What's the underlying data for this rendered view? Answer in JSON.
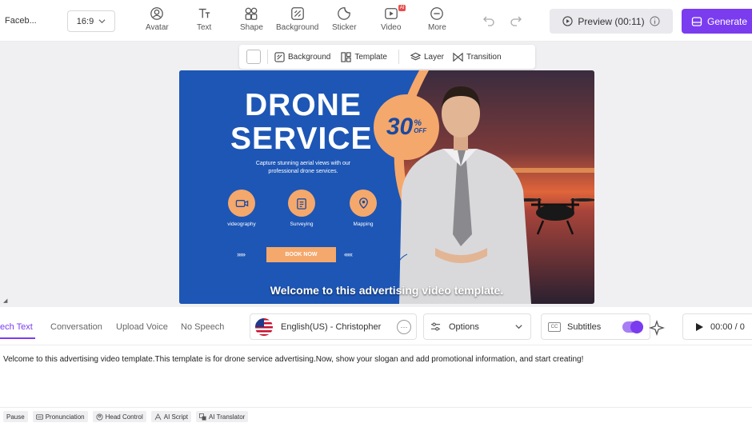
{
  "topbar": {
    "project_name": "Faceb...",
    "aspect_ratio": "16:9",
    "tools": [
      {
        "label": "Avatar",
        "icon": "avatar-icon"
      },
      {
        "label": "Text",
        "icon": "text-icon"
      },
      {
        "label": "Shape",
        "icon": "shape-icon"
      },
      {
        "label": "Background",
        "icon": "background-icon"
      },
      {
        "label": "Sticker",
        "icon": "sticker-icon"
      },
      {
        "label": "Video",
        "icon": "video-icon",
        "badge": "AI"
      },
      {
        "label": "More",
        "icon": "more-icon"
      }
    ],
    "preview_label": "Preview (00:11)",
    "generate_label": "Generate"
  },
  "subtoolbar": {
    "background_label": "Background",
    "template_label": "Template",
    "layer_label": "Layer",
    "transition_label": "Transition"
  },
  "video": {
    "title_line1": "DRONE",
    "title_line2": "SERVICE",
    "subtitle_line1": "Capture stunning aerial views with our",
    "subtitle_line2": "professional drone services.",
    "discount_number": "30",
    "discount_symbol": "%",
    "discount_off": "OFF",
    "features": [
      "videography",
      "Surveying",
      "Mapping"
    ],
    "cta": "BOOK NOW",
    "arrows_left": "›››››",
    "arrows_right": "‹‹‹‹‹",
    "caption": "Welcome to this advertising video template."
  },
  "panel": {
    "tabs": [
      "ech Text",
      "Conversation",
      "Upload Voice",
      "No Speech"
    ],
    "voice": "English(US) - Christopher",
    "voice_more": "···",
    "options_label": "Options",
    "subtitles_label": "Subtitles",
    "cc_label": "CC",
    "time": "00:00 / 0",
    "script": "Velcome to this advertising video template.This template is for drone service advertising.Now, show your slogan and add promotional information, and start creating!"
  },
  "bottom_tools": [
    "Pause",
    "Pronunciation",
    "Head Control",
    "AI Script",
    "AI Translator"
  ],
  "colors": {
    "accent": "#7b3cf0",
    "video_blue": "#1a4aa0",
    "video_orange": "#f5a86b"
  }
}
